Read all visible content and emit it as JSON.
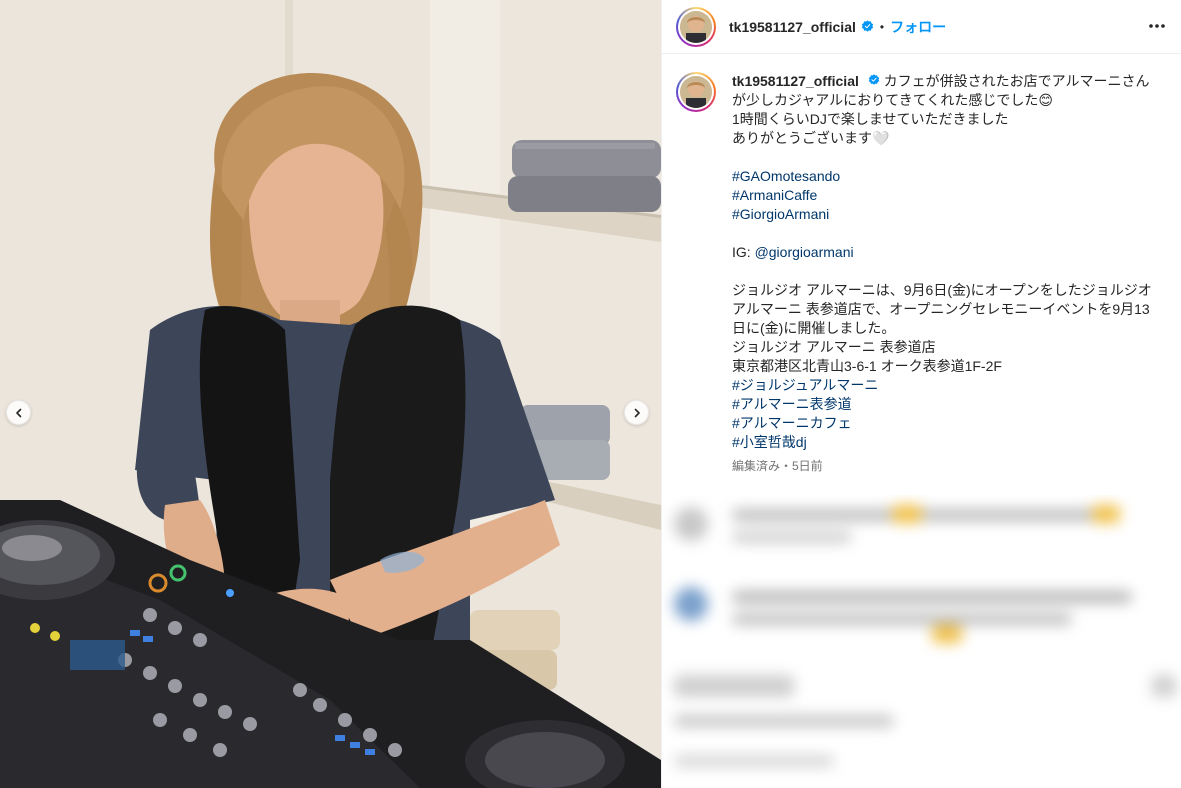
{
  "post": {
    "username": "tk19581127_official",
    "follow_label": "フォロー",
    "separator": "•",
    "caption_username": "tk19581127_official",
    "caption_lines": [
      "カフェが併設されたお店でアルマーニさんが少しカジャアルにおりてきてくれた感じでした😊",
      "1時間くらいDJで楽しませていただきました",
      "ありがとうございます🤍",
      "",
      "#GAOmotesando",
      "#ArmaniCaffe",
      "#GiorgioArmani",
      "",
      "IG: @giorgioarmani",
      "",
      "ジョルジオ アルマーニは、9月6日(金)にオープンをしたジョルジオ アルマーニ 表参道店で、オープニングセレモニーイベントを9月13日に(金)に開催しました。",
      "ジョルジオ アルマーニ 表参道店",
      "東京都港区北青山3-6-1 オーク表参道1F-2F",
      "#ジョルジュアルマーニ",
      "#アルマーニ表参道",
      "#アルマーニカフェ",
      "#小室哲哉dj"
    ],
    "timestamp": "編集済み・5日前"
  },
  "colors": {
    "follow": "#0095f6",
    "hashtag": "#00376b",
    "verified": "#0095f6",
    "text": "#262626",
    "muted": "#737373"
  },
  "icons": {
    "verified": "verified-badge-icon",
    "more": "more-options-icon",
    "prev": "chevron-left-icon",
    "next": "chevron-right-icon"
  }
}
